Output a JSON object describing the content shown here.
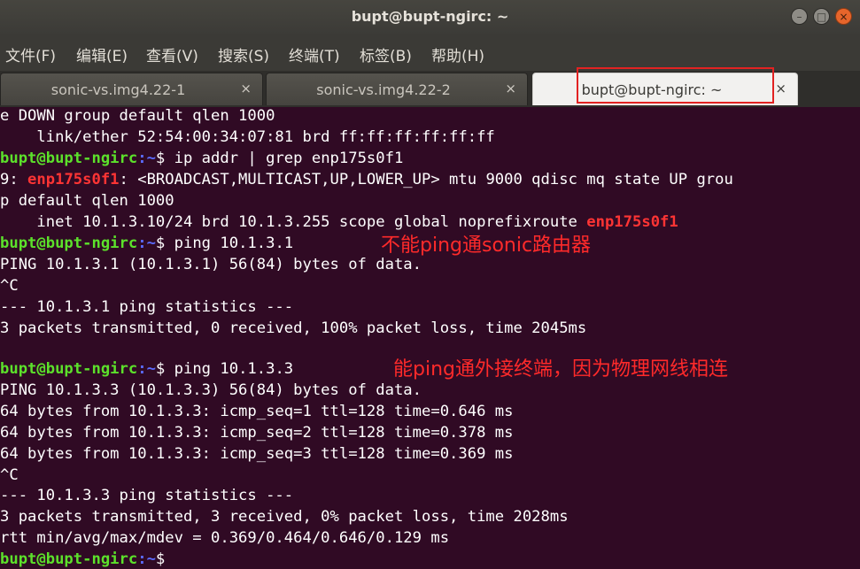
{
  "window": {
    "title": "bupt@bupt-ngirc: ~",
    "min_glyph": "–",
    "max_glyph": "□",
    "close_glyph": "×"
  },
  "menu": [
    "文件(F)",
    "编辑(E)",
    "查看(V)",
    "搜索(S)",
    "终端(T)",
    "标签(B)",
    "帮助(H)"
  ],
  "tabs": [
    {
      "label": "sonic-vs.img4.22-1",
      "close": "×"
    },
    {
      "label": "sonic-vs.img4.22-2",
      "close": "×"
    },
    {
      "label": "bupt@bupt-ngirc: ~",
      "close": "×"
    }
  ],
  "toolbar": {
    "new_tab_icon": "new-tab-icon",
    "menu_icon": "hamburger-menu-icon"
  },
  "prompt": {
    "user": "bupt@bupt-ngirc",
    "path": ":~",
    "symbol": "$"
  },
  "terminal": {
    "l1": "e DOWN group default qlen 1000",
    "l2": "    link/ether 52:54:00:34:07:81 brd ff:ff:ff:ff:ff:ff",
    "l3_cmd": " ip addr | grep enp175s0f1",
    "l4_pre": "9: ",
    "l4_iface": "enp175s0f1",
    "l4_post": ": <BROADCAST,MULTICAST,UP,LOWER_UP> mtu 9000 qdisc mq state UP grou",
    "l5": "p default qlen 1000",
    "l6_pre": "    inet 10.1.3.10/24 brd 10.1.3.255 scope global noprefixroute ",
    "l6_iface": "enp175s0f1",
    "l7_cmd": " ping 10.1.3.1",
    "l8": "PING 10.1.3.1 (10.1.3.1) 56(84) bytes of data.",
    "l9": "^C",
    "l10": "--- 10.1.3.1 ping statistics ---",
    "l11": "3 packets transmitted, 0 received, 100% packet loss, time 2045ms",
    "l13_cmd": " ping 10.1.3.3",
    "l14": "PING 10.1.3.3 (10.1.3.3) 56(84) bytes of data.",
    "l15": "64 bytes from 10.1.3.3: icmp_seq=1 ttl=128 time=0.646 ms",
    "l16": "64 bytes from 10.1.3.3: icmp_seq=2 ttl=128 time=0.378 ms",
    "l17": "64 bytes from 10.1.3.3: icmp_seq=3 ttl=128 time=0.369 ms",
    "l18": "^C",
    "l19": "--- 10.1.3.3 ping statistics ---",
    "l20": "3 packets transmitted, 3 received, 0% packet loss, time 2028ms",
    "l21": "rtt min/avg/max/mdev = 0.369/0.464/0.646/0.129 ms"
  },
  "annotations": {
    "a1": "不能ping通sonic路由器",
    "a2": "能ping通外接终端，因为物理网线相连"
  },
  "colors": {
    "terminal_bg": "#300a24",
    "prompt_user": "#5ce12b",
    "prompt_path": "#5b6bff",
    "iface_highlight": "#ff3434",
    "annotation": "#ff2a2a",
    "tab_highlight_box": "#e22222"
  }
}
